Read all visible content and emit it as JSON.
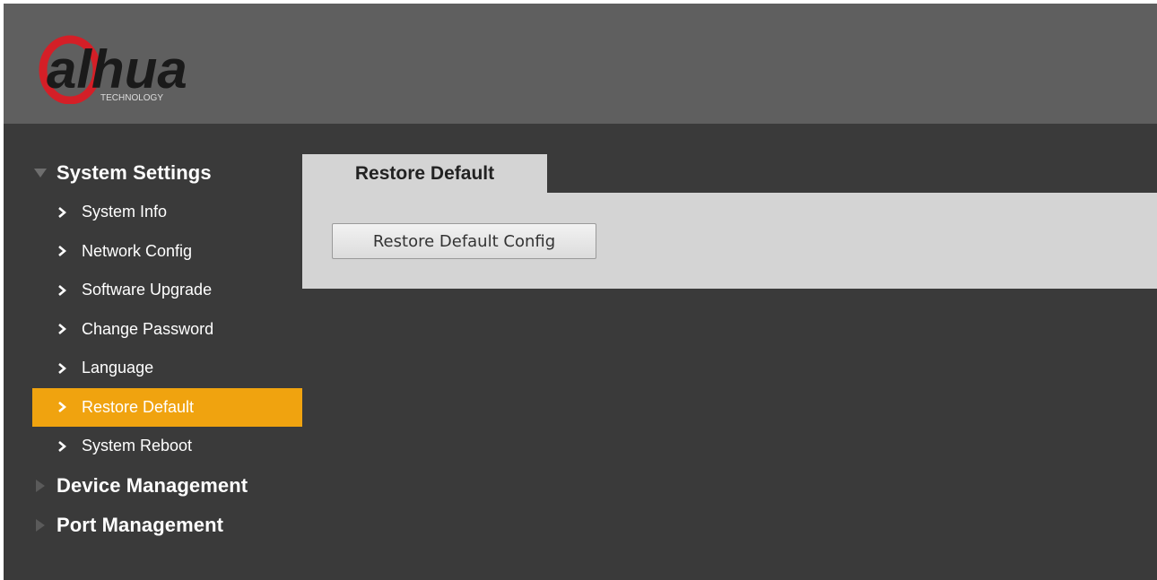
{
  "brand": {
    "logo_text": "alhua",
    "logo_subtext": "TECHNOLOGY",
    "logo_color": "#d41f27"
  },
  "colors": {
    "header_bg": "#5f5f5f",
    "body_bg": "#3a3a3a",
    "active_bg": "#f0a30f",
    "panel_bg": "#d4d4d4"
  },
  "sidebar": {
    "groups": [
      {
        "label": "System Settings",
        "expanded": true,
        "items": [
          {
            "label": "System Info"
          },
          {
            "label": "Network Config"
          },
          {
            "label": "Software Upgrade"
          },
          {
            "label": "Change Password"
          },
          {
            "label": "Language"
          },
          {
            "label": "Restore Default",
            "active": true
          },
          {
            "label": "System Reboot"
          }
        ]
      },
      {
        "label": "Device Management",
        "expanded": false
      },
      {
        "label": "Port Management",
        "expanded": false
      }
    ]
  },
  "main": {
    "tab_label": "Restore Default",
    "restore_button_label": "Restore Default Config"
  }
}
